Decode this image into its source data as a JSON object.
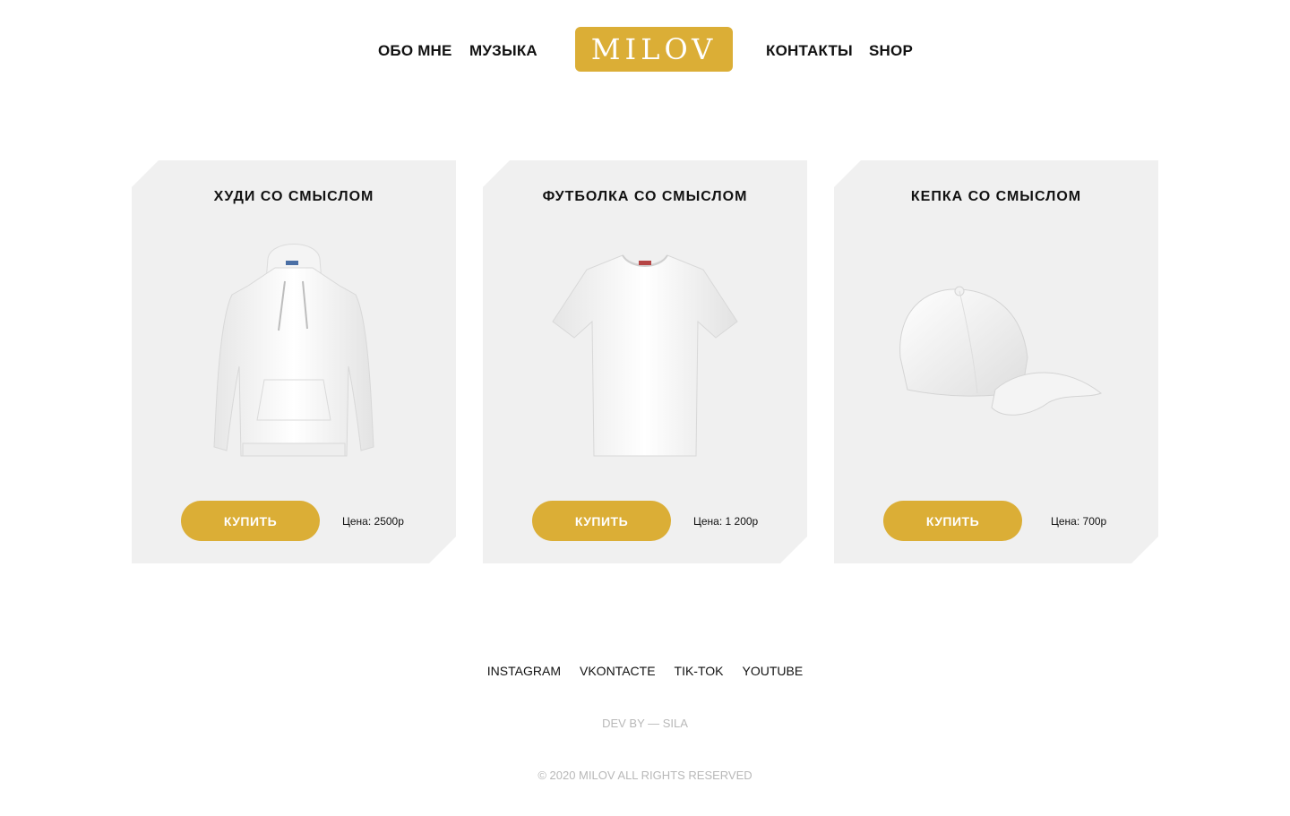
{
  "header": {
    "nav_left": [
      "ОБО МНЕ",
      "МУЗЫКА"
    ],
    "logo": "MILOV",
    "nav_right": [
      "КОНТАКТЫ",
      "SHOP"
    ]
  },
  "products": [
    {
      "title": "ХУДИ СО СМЫСЛОМ",
      "image": "hoodie-icon",
      "buy_label": "КУПИТЬ",
      "price": "Цена: 2500р"
    },
    {
      "title": "ФУТБОЛКА СО СМЫСЛОМ",
      "image": "tshirt-icon",
      "buy_label": "КУПИТЬ",
      "price": "Цена: 1 200р"
    },
    {
      "title": "КЕПКА СО СМЫСЛОМ",
      "image": "cap-icon",
      "buy_label": "КУПИТЬ",
      "price": "Цена: 700р"
    }
  ],
  "footer": {
    "socials": [
      "INSTAGRAM",
      "VKONTACTE",
      "TIK-TOK",
      "YOUTUBE"
    ],
    "dev_by": "DEV BY — SILA",
    "copyright": "© 2020 MILOV ALL RIGHTS RESERVED"
  },
  "colors": {
    "accent": "#dbae36",
    "card_bg": "#f0f0f0",
    "muted_text": "#b8b8b8"
  }
}
